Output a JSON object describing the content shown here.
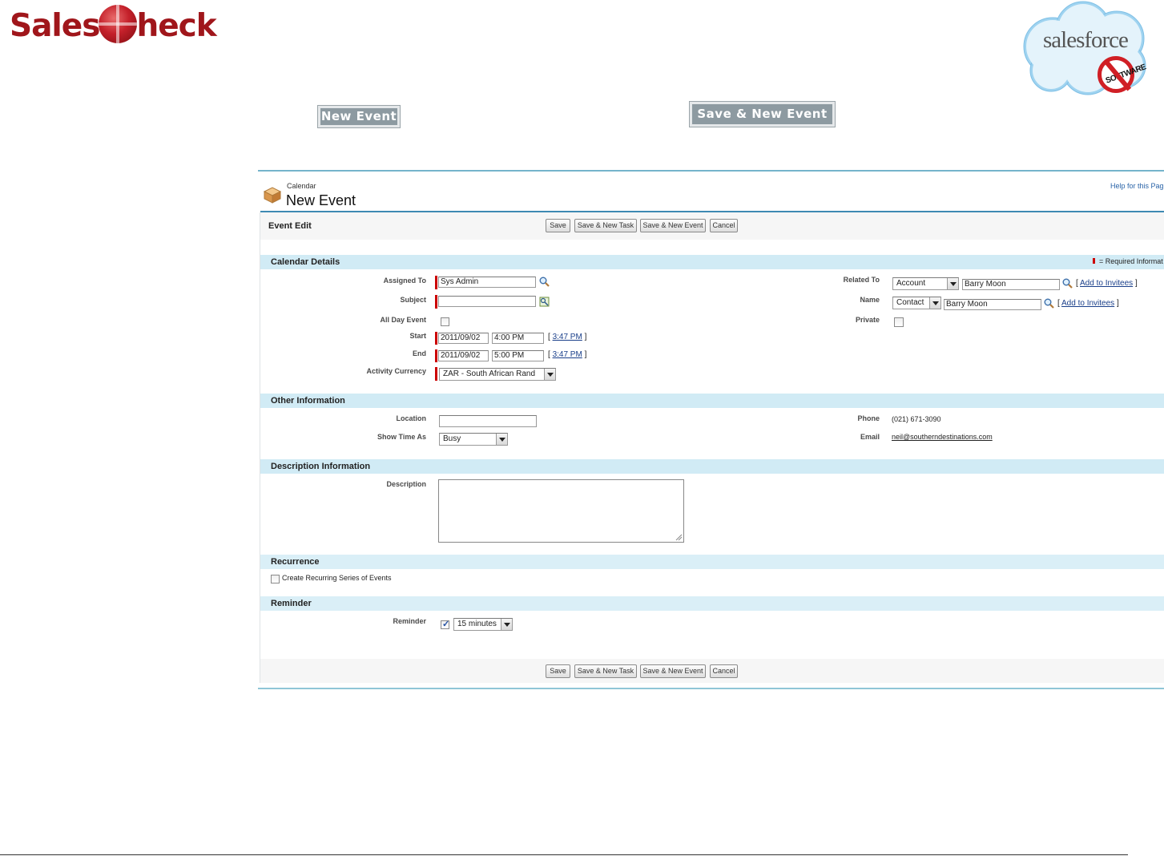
{
  "branding": {
    "logo_left": "Sales",
    "logo_right": "heck",
    "cloud_text": "salesforce",
    "stamp_text": "SOFTWARE"
  },
  "demo_buttons": {
    "new_event": "New Event",
    "save_new_event": "Save & New Event"
  },
  "header": {
    "breadcrumb": "Calendar",
    "title": "New Event",
    "help_link": "Help for this Pag"
  },
  "page_block": {
    "title": "Event Edit",
    "buttons": {
      "save": "Save",
      "save_new_task": "Save & New Task",
      "save_new_event": "Save & New Event",
      "cancel": "Cancel"
    },
    "required_note": "= Required Informat"
  },
  "sections": {
    "calendar_details": "Calendar Details",
    "other_information": "Other Information",
    "description_information": "Description Information",
    "recurrence": "Recurrence",
    "reminder": "Reminder"
  },
  "fields": {
    "assigned_to": {
      "label": "Assigned To",
      "value": "Sys Admin"
    },
    "subject": {
      "label": "Subject",
      "value": ""
    },
    "all_day_event": {
      "label": "All Day Event",
      "checked": false
    },
    "start": {
      "label": "Start",
      "date": "2011/09/02",
      "time": "4:00 PM",
      "now_link": "3:47 PM"
    },
    "end": {
      "label": "End",
      "date": "2011/09/02",
      "time": "5:00 PM",
      "now_link": "3:47 PM"
    },
    "activity_currency": {
      "label": "Activity Currency",
      "value": "ZAR - South African Rand"
    },
    "related_to": {
      "label": "Related To",
      "type": "Account",
      "value": "Barry Moon",
      "add_link": "Add to Invitees"
    },
    "name": {
      "label": "Name",
      "type": "Contact",
      "value": "Barry Moon",
      "add_link": "Add to Invitees"
    },
    "private": {
      "label": "Private",
      "checked": false
    },
    "location": {
      "label": "Location",
      "value": ""
    },
    "show_time_as": {
      "label": "Show Time As",
      "value": "Busy"
    },
    "phone": {
      "label": "Phone",
      "value": "(021) 671-3090"
    },
    "email": {
      "label": "Email",
      "value": "neil@southerndestinations.com"
    },
    "description": {
      "label": "Description",
      "value": ""
    },
    "recurring": {
      "label": "Create Recurring Series of Events",
      "checked": false
    },
    "reminder": {
      "label": "Reminder",
      "checked": true,
      "value": "15 minutes"
    }
  },
  "colors": {
    "brand_red": "#a0161b",
    "section_bg": "#d1ebf5",
    "frame_blue": "#3e8ab3",
    "required_red": "#cc0000"
  }
}
